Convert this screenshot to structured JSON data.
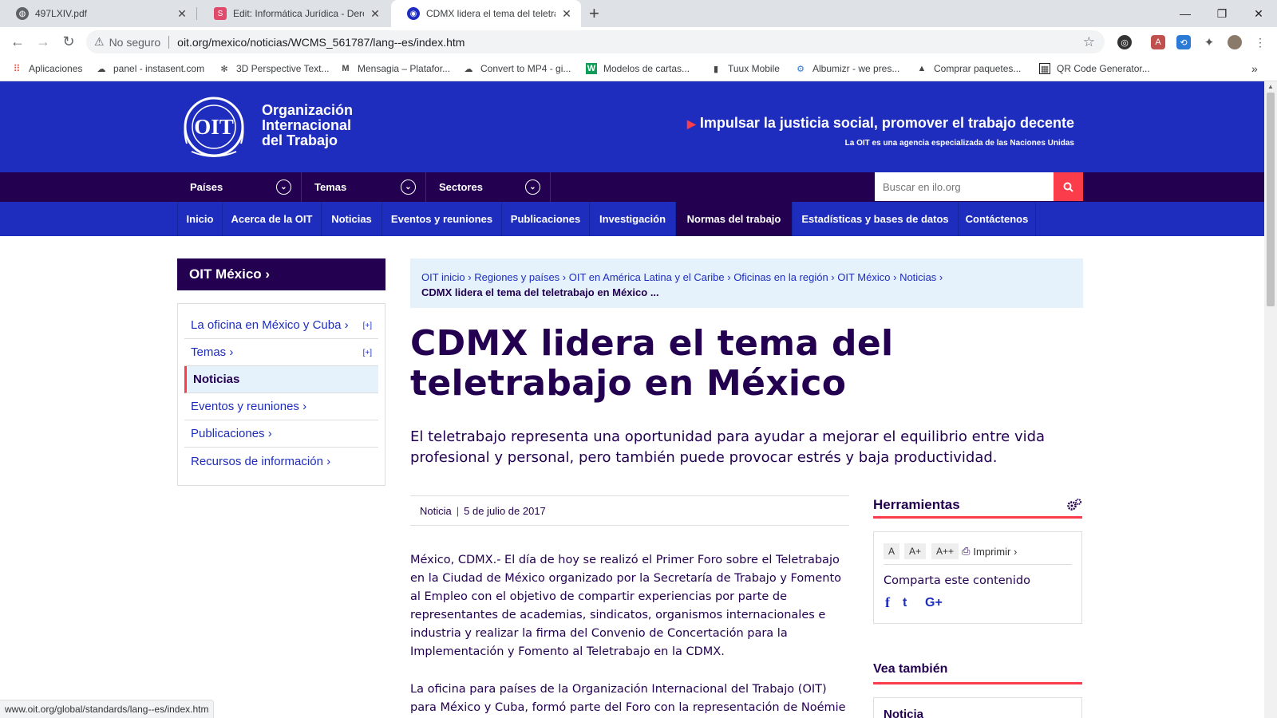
{
  "browser": {
    "tabs": [
      {
        "title": "497LXIV.pdf",
        "active": false
      },
      {
        "title": "Edit: Informática Jurídica - Derech",
        "active": false
      },
      {
        "title": "CDMX lidera el tema del teletrab",
        "active": true
      }
    ],
    "new_tab": "+",
    "omnibox": {
      "security": "No seguro",
      "url": "oit.org/mexico/noticias/WCMS_561787/lang--es/index.htm"
    },
    "bookmarks": [
      "Aplicaciones",
      "panel - instasent.com",
      "3D Perspective Text...",
      "Mensagia – Platafor...",
      "Convert to MP4 - gi...",
      "Modelos de cartas...",
      "Tuux Mobile",
      "Albumizr - we pres...",
      "Comprar paquetes...",
      "QR Code Generator..."
    ],
    "status_url": "www.oit.org/global/standards/lang--es/index.htm"
  },
  "header": {
    "org_line1": "Organización",
    "org_line2": "Internacional",
    "org_line3": "del Trabajo",
    "logo_text": "OIT",
    "slogan": "Impulsar la justicia social, promover el trabajo decente",
    "agency": "La OIT es una agencia especializada de las Naciones Unidas"
  },
  "nav_top": {
    "dropdowns": [
      "Países",
      "Temas",
      "Sectores"
    ],
    "search_placeholder": "Buscar en ilo.org"
  },
  "nav_main": {
    "items": [
      "Inicio",
      "Acerca de la OIT",
      "Noticias",
      "Eventos y reuniones",
      "Publicaciones",
      "Investigación",
      "Normas del trabajo",
      "Estadísticas y bases de datos",
      "Contáctenos"
    ],
    "active": "Normas del trabajo"
  },
  "sidebar": {
    "heading": "OIT México ›",
    "items": [
      {
        "label": "La oficina en México y Cuba ›",
        "expand": "[+]"
      },
      {
        "label": "Temas ›",
        "expand": "[+]"
      },
      {
        "label": "Noticias",
        "active": true
      },
      {
        "label": "Eventos y reuniones  ›"
      },
      {
        "label": "Publicaciones ›"
      },
      {
        "label": "Recursos de información  ›"
      }
    ]
  },
  "breadcrumb": {
    "items": [
      "OIT inicio ›",
      "Regiones y países ›",
      "OIT en América Latina y el Caribe ›",
      "Oficinas en la región ›",
      "OIT México ›",
      "Noticias ›"
    ],
    "current": "CDMX lidera el tema del teletrabajo en México ..."
  },
  "article": {
    "title": "CDMX lidera el tema del teletrabajo en México",
    "lead": "El teletrabajo representa una oportunidad para ayudar a mejorar el equilibrio entre vida profesional y personal, pero también puede provocar estrés y baja productividad.",
    "type": "Noticia",
    "separator": "|",
    "date": "5 de julio de 2017",
    "paragraph1": "México, CDMX.- El día de hoy se realizó el Primer Foro sobre el Teletrabajo en la Ciudad de México organizado por la Secretaría de Trabajo y Fomento al Empleo con el objetivo de compartir experiencias por parte de representantes de academias, sindicatos, organismos internacionales e industria y realizar la firma del Convenio de Concertación para la Implementación y Fomento al Teletrabajo en la CDMX.",
    "paragraph2": "La oficina para países de la Organización Internacional del Trabajo (OIT) para México y Cuba, formó parte del Foro con la representación de Noémie Feix,"
  },
  "tools": {
    "heading": "Herramientas",
    "font_sizes": [
      "A",
      "A+",
      "A++"
    ],
    "print_label": "Imprimir ›",
    "share_label": "Comparta este contenido",
    "social": [
      "f",
      "t",
      "G+"
    ]
  },
  "see_also": {
    "heading": "Vea también",
    "first_item": "Noticia"
  },
  "colors": {
    "ilo_blue": "#1e2dbe",
    "ilo_purple": "#230050",
    "ilo_red": "#fa3c4b",
    "light_blue": "#e5f2fc"
  }
}
